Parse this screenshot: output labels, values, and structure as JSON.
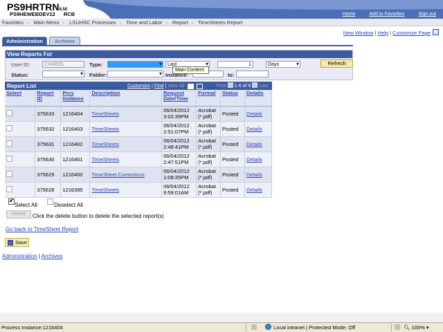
{
  "header": {
    "system_name": "PS9HRTRN",
    "version": "8.50",
    "environment": "PS9HEWEBDEV12",
    "site": "RCB",
    "links": [
      "Home",
      "Add to Favorites",
      "Sign out"
    ]
  },
  "breadcrumb": [
    "Favorites",
    "Main Menu",
    "LSUHSC Processes",
    "Time and Labor",
    "Report",
    "TimeSheets Report"
  ],
  "page_links": [
    "New Window",
    "Help",
    "Customize Page"
  ],
  "tabs": {
    "active": "Administration",
    "inactive": "Archives"
  },
  "view_reports": {
    "title": "View Reports For",
    "user_id_label": "User ID:",
    "user_id_value": "CHAROL",
    "type_label": "Type:",
    "last_value": "Last",
    "count_value": "1",
    "days_value": "Days",
    "refresh_label": "Refresh",
    "status_label": "Status:",
    "folder_label": "Folder:",
    "instance_label": "Instance:",
    "to_label": "to:",
    "tooltip": "Main Content"
  },
  "report_list": {
    "title": "Report List",
    "customize": "Customize",
    "find": "Find",
    "view_all": "View All",
    "first": "First",
    "range": "1-6 of 6",
    "last": "Last",
    "columns": [
      "Select",
      "Report ID",
      "Prcs Instance",
      "Description",
      "Request Date/Time",
      "Format",
      "Status",
      "Details"
    ],
    "rows": [
      {
        "report_id": "375633",
        "prcs": "1216404",
        "desc": "TimeSheets",
        "date": "06/04/2012",
        "time": "3:02:39PM",
        "format1": "Acrobat",
        "format2": "(*.pdf)",
        "status": "Posted",
        "details": "Details"
      },
      {
        "report_id": "375632",
        "prcs": "1216403",
        "desc": "TimeSheets",
        "date": "06/04/2012",
        "time": "2:51:07PM",
        "format1": "Acrobat",
        "format2": "(*.pdf)",
        "status": "Posted",
        "details": "Details"
      },
      {
        "report_id": "375631",
        "prcs": "1216402",
        "desc": "TimeSheets",
        "date": "06/04/2012",
        "time": "2:48:41PM",
        "format1": "Acrobat",
        "format2": "(*.pdf)",
        "status": "Posted",
        "details": "Details"
      },
      {
        "report_id": "375630",
        "prcs": "1216401",
        "desc": "TimeSheets",
        "date": "06/04/2012",
        "time": "2:47:51PM",
        "format1": "Acrobat",
        "format2": "(*.pdf)",
        "status": "Posted",
        "details": "Details"
      },
      {
        "report_id": "375629",
        "prcs": "1216400",
        "desc": "TimeSheet Corrections",
        "date": "06/04/2012",
        "time": "1:08:35PM",
        "format1": "Acrobat",
        "format2": "(*.pdf)",
        "status": "Posted",
        "details": "Details"
      },
      {
        "report_id": "375628",
        "prcs": "1216395",
        "desc": "TimeSheets",
        "date": "06/04/2012",
        "time": "9:59:01AM",
        "format1": "Acrobat",
        "format2": "(*.pdf)",
        "status": "Posted",
        "details": "Details"
      }
    ]
  },
  "actions": {
    "select_all": "Select All",
    "deselect_all": "Deselect All",
    "delete_label": "Delete",
    "delete_hint": "Click the delete button to delete the selected report(s)",
    "go_back": "Go back to TimeSheet Report",
    "save": "Save"
  },
  "bottom_links": [
    "Administration",
    "Archives"
  ],
  "statusbar": {
    "left": "Process Instance:1216404",
    "zone": "Local intranet | Protected Mode: Off",
    "zoom": "100%"
  },
  "colors": {
    "brand": "#3b5b9e",
    "link": "#2a41b4",
    "button": "#f5eaa6"
  }
}
